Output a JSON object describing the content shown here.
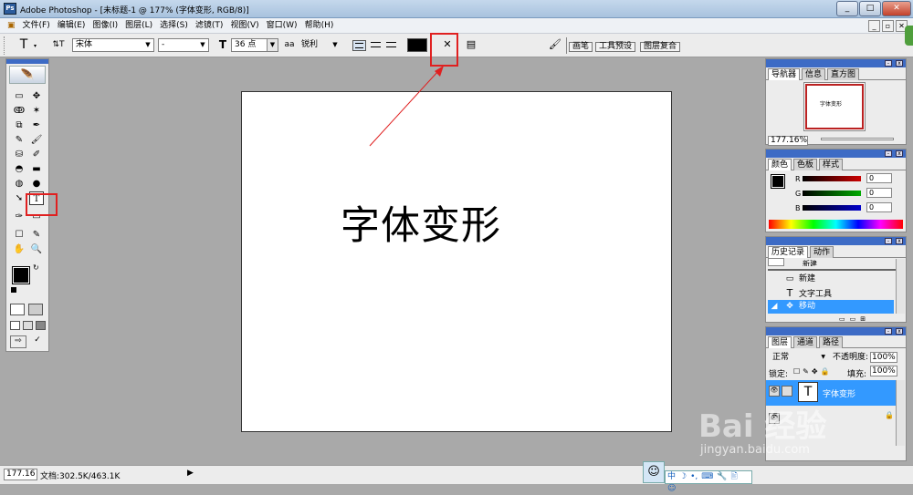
{
  "window": {
    "title": "Adobe Photoshop - [未标题-1 @ 177% (字体变形, RGB/8)]",
    "app_icon": "Ps",
    "buttons": [
      "_",
      "□",
      "✕"
    ],
    "doc_buttons": [
      "_",
      "▫",
      "✕"
    ]
  },
  "menu": [
    "文件(F)",
    "编辑(E)",
    "图像(I)",
    "图层(L)",
    "选择(S)",
    "滤镜(T)",
    "视图(V)",
    "窗口(W)",
    "帮助(H)"
  ],
  "options": {
    "tool_icon": "T",
    "orient_icon": "⇅T",
    "font_family": "宋体",
    "font_style": "-",
    "size_icon": "T",
    "font_size": "36 点",
    "aa_icon": "aa",
    "antialias": "锐利",
    "color_swatch": "#000000",
    "warp_icon": "✕",
    "palette_icon": "▤",
    "brush_icon": "🖌",
    "tabs": [
      "画笔",
      "工具预设",
      "图层复合"
    ]
  },
  "canvas": {
    "text": "字体变形"
  },
  "navigator": {
    "tabs": [
      "导航器",
      "信息",
      "直方图"
    ],
    "preview_text": "字体变形",
    "zoom": "177.16%"
  },
  "color": {
    "tabs": [
      "颜色",
      "色板",
      "样式"
    ],
    "channels": [
      {
        "label": "R",
        "value": "0",
        "color": "#cc0000"
      },
      {
        "label": "G",
        "value": "0",
        "color": "#00aa00"
      },
      {
        "label": "B",
        "value": "0",
        "color": "#0000cc"
      }
    ]
  },
  "history": {
    "tabs": [
      "历史记录",
      "动作"
    ],
    "partial_item": "新建",
    "items": [
      {
        "icon": "▭",
        "label": "新建"
      },
      {
        "icon": "T",
        "label": "文字工具"
      },
      {
        "icon": "✥",
        "label": "移动"
      }
    ]
  },
  "layers": {
    "tabs": [
      "图层",
      "通道",
      "路径"
    ],
    "blend_mode": "正常",
    "opacity_label": "不透明度:",
    "opacity": "100%",
    "lock_label": "锁定:",
    "fill_label": "填充:",
    "fill": "100%",
    "layer_name": "字体变形",
    "layer_icon": "T"
  },
  "status": {
    "zoom": "177.16",
    "doc": "文档:302.5K/463.1K",
    "arrow": "▶"
  },
  "ime": {
    "items": [
      "中",
      "☽",
      "•,",
      "⌨",
      "🔧",
      "🖹",
      "☺"
    ]
  },
  "watermark": {
    "logo": "Bai 经验",
    "url": "jingyan.baidu.com"
  },
  "tools": [
    "▭",
    "✥",
    "ↂ",
    "✶",
    "⧉",
    "✒",
    "✎",
    "🖌",
    "⛁",
    "✐",
    "◓",
    "▬",
    "◍",
    "●",
    "➘",
    "T",
    "✑",
    "▭",
    "☐",
    "✎",
    "✋",
    "🔍"
  ],
  "colors": {
    "accent": "#3d6bc5",
    "highlight": "#3399ff",
    "annotation": "#e02020"
  }
}
